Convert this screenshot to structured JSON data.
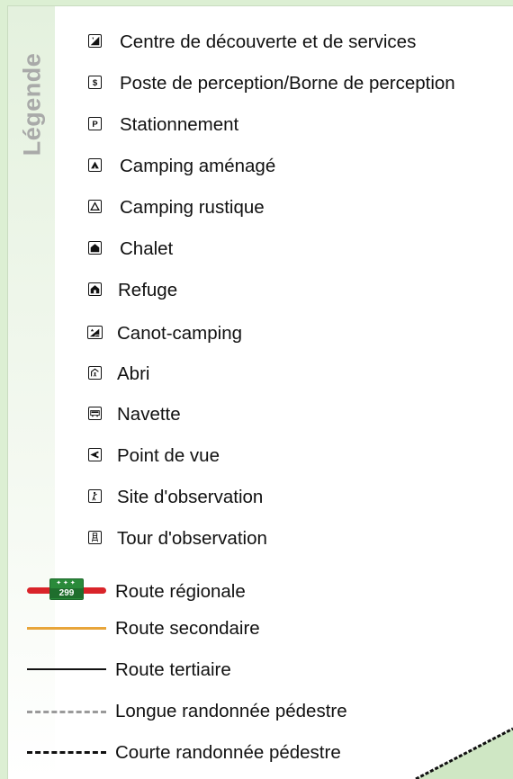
{
  "legend": {
    "title": "Légende",
    "symbols": [
      {
        "label": "Centre de découverte et de services",
        "icon": "discovery-center-icon"
      },
      {
        "label": "Poste de perception/Borne de perception",
        "icon": "dollar-icon"
      },
      {
        "label": "Stationnement",
        "icon": "parking-icon"
      },
      {
        "label": "Camping aménagé",
        "icon": "tent-filled-icon"
      },
      {
        "label": "Camping rustique",
        "icon": "tent-outline-icon"
      },
      {
        "label": "Chalet",
        "icon": "chalet-icon"
      },
      {
        "label": "Refuge",
        "icon": "refuge-icon"
      },
      {
        "label": "Canot-camping",
        "icon": "canoe-camping-icon"
      },
      {
        "label": "Abri",
        "icon": "shelter-icon"
      },
      {
        "label": "Navette",
        "icon": "shuttle-icon"
      },
      {
        "label": "Point de vue",
        "icon": "viewpoint-icon"
      },
      {
        "label": "Site d'observation",
        "icon": "observation-site-icon"
      },
      {
        "label": "Tour d'observation",
        "icon": "observation-tower-icon"
      }
    ],
    "lines": [
      {
        "label": "Route régionale",
        "shield_number": "299",
        "color": "#d9242a"
      },
      {
        "label": "Route secondaire",
        "color": "#e8a53a"
      },
      {
        "label": "Route tertiaire",
        "color": "#111111"
      },
      {
        "label": "Longue randonnée pédestre",
        "color": "#9a9a9a"
      },
      {
        "label": "Courte randonnée pédestre",
        "color": "#111111"
      }
    ]
  },
  "colors": {
    "background": "#dcefd3",
    "title": "#a9aaa9",
    "shield": "#2a8a3a"
  }
}
